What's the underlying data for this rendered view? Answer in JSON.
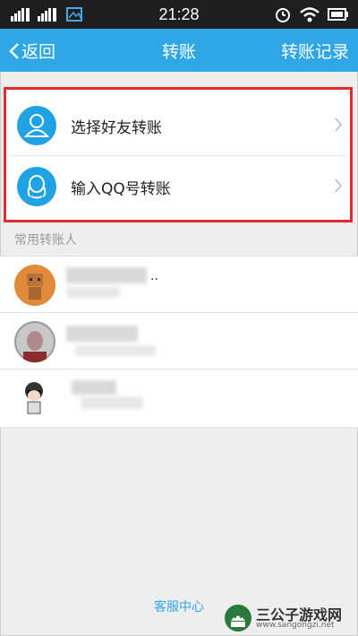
{
  "status_bar": {
    "time": "21:28",
    "left_icons": [
      "signal-icon",
      "signal-icon",
      "image-icon"
    ],
    "right_icons": [
      "alarm-icon",
      "wifi-icon",
      "battery-icon"
    ]
  },
  "nav": {
    "back_label": "返回",
    "title": "转账",
    "right_label": "转账记录",
    "color": "#2fa7e6"
  },
  "options": [
    {
      "label": "选择好友转账",
      "icon": "person-icon"
    },
    {
      "label": "输入QQ号转账",
      "icon": "qq-person-icon"
    }
  ],
  "section_label": "常用转账人",
  "contacts": [
    {
      "name_suffix": ".."
    },
    {
      "name_suffix": ""
    },
    {
      "name_suffix": ""
    }
  ],
  "footer_link": "客服中心",
  "watermark": {
    "title": "三公子游戏网",
    "url": "www.sangongzi.net"
  },
  "colors": {
    "accent": "#2fa7e6",
    "highlight_border": "#e22c2c"
  }
}
